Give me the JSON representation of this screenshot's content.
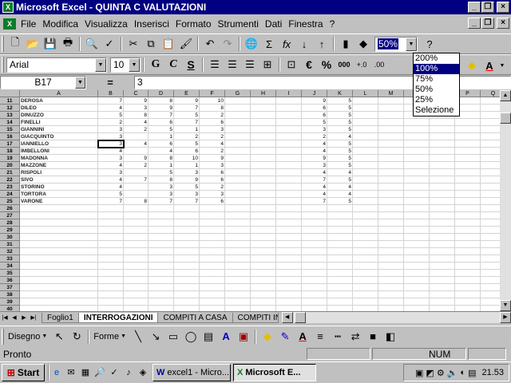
{
  "window": {
    "title": "Microsoft Excel - QUINTA C VALUTAZIONI",
    "minimize": "_",
    "restore": "❐",
    "close": "×"
  },
  "menu": {
    "items": [
      "File",
      "Modifica",
      "Visualizza",
      "Inserisci",
      "Formato",
      "Strumenti",
      "Dati",
      "Finestra",
      "?"
    ]
  },
  "toolbar": {
    "zoom_value": "50%",
    "help_label": "?"
  },
  "format": {
    "font_name": "Arial",
    "font_size": "10",
    "bold": "G",
    "italic": "C",
    "underline": "S",
    "currency": "€",
    "percent": "%",
    "thousands": "000"
  },
  "zoom_dropdown": {
    "options": [
      "200%",
      "100%",
      "75%",
      "50%",
      "25%",
      "Selezione"
    ],
    "highlighted_index": 1
  },
  "formula_bar": {
    "name_box": "B17",
    "equals": "=",
    "content": "3"
  },
  "sheet": {
    "columns": [
      "A",
      "B",
      "C",
      "D",
      "E",
      "F",
      "G",
      "H",
      "I",
      "J",
      "K",
      "L",
      "M",
      "N",
      "O",
      "P",
      "Q"
    ],
    "first_row": 11,
    "last_row": 40,
    "active_cell": "B17",
    "rows": [
      {
        "row": 11,
        "name": "DEROSA",
        "b": "7",
        "c": "9",
        "d": "8",
        "e": "9",
        "f": "10",
        "j": "9",
        "k": "5"
      },
      {
        "row": 12,
        "name": "DILEO",
        "b": "4",
        "c": "3",
        "d": "9",
        "e": "7",
        "f": "8",
        "j": "6",
        "k": "5"
      },
      {
        "row": 13,
        "name": "DINUZZO",
        "b": "5",
        "c": "8",
        "d": "7",
        "e": "5",
        "f": "2",
        "j": "6",
        "k": "5"
      },
      {
        "row": 14,
        "name": "FINELLI",
        "b": "2",
        "c": "4",
        "d": "6",
        "e": "7",
        "f": "6",
        "j": "5",
        "k": "5"
      },
      {
        "row": 15,
        "name": "GIANNINI",
        "b": "3",
        "c": "2",
        "d": "5",
        "e": "1",
        "f": "3",
        "j": "3",
        "k": "5"
      },
      {
        "row": 16,
        "name": "GIACQUINTO",
        "b": "3",
        "c": "",
        "d": "1",
        "e": "2",
        "f": "2",
        "j": "2",
        "k": "4"
      },
      {
        "row": 17,
        "name": "IANNIELLO",
        "b": "3",
        "c": "4",
        "d": "6",
        "e": "5",
        "f": "4",
        "j": "4",
        "k": "5"
      },
      {
        "row": 18,
        "name": "IMBELLONI",
        "b": "4",
        "c": "",
        "d": "4",
        "e": "6",
        "f": "2",
        "j": "4",
        "k": "5"
      },
      {
        "row": 19,
        "name": "MADONNA",
        "b": "3",
        "c": "9",
        "d": "8",
        "e": "10",
        "f": "9",
        "j": "9",
        "k": "5"
      },
      {
        "row": 20,
        "name": "MAZZONE",
        "b": "4",
        "c": "2",
        "d": "1",
        "e": "1",
        "f": "3",
        "j": "3",
        "k": "5"
      },
      {
        "row": 21,
        "name": "RISPOLI",
        "b": "3",
        "c": "",
        "d": "5",
        "e": "3",
        "f": "6",
        "j": "4",
        "k": "4"
      },
      {
        "row": 22,
        "name": "SIVO",
        "b": "4",
        "c": "7",
        "d": "8",
        "e": "9",
        "f": "6",
        "j": "7",
        "k": "5"
      },
      {
        "row": 23,
        "name": "STORINO",
        "b": "4",
        "c": "",
        "d": "3",
        "e": "5",
        "f": "2",
        "j": "4",
        "k": "4"
      },
      {
        "row": 24,
        "name": "TORTORA",
        "b": "5",
        "c": "",
        "d": "3",
        "e": "3",
        "f": "3",
        "j": "4",
        "k": "4"
      },
      {
        "row": 25,
        "name": "VARONE",
        "b": "7",
        "c": "8",
        "d": "7",
        "e": "7",
        "f": "6",
        "j": "7",
        "k": "5"
      }
    ]
  },
  "tabs": {
    "items": [
      "Foglio1",
      "INTERROGAZIONI",
      "COMPITI A CASA",
      "COMPITI IN C"
    ],
    "active_index": 1
  },
  "drawing": {
    "draw_label": "Disegno",
    "shapes_label": "Forme"
  },
  "status": {
    "text": "Pronto",
    "num": "NUM"
  },
  "taskbar": {
    "start": "Start",
    "tasks": [
      "excel1 - Micro...",
      "Microsoft E..."
    ],
    "active_task": 1,
    "clock": "21.53"
  }
}
